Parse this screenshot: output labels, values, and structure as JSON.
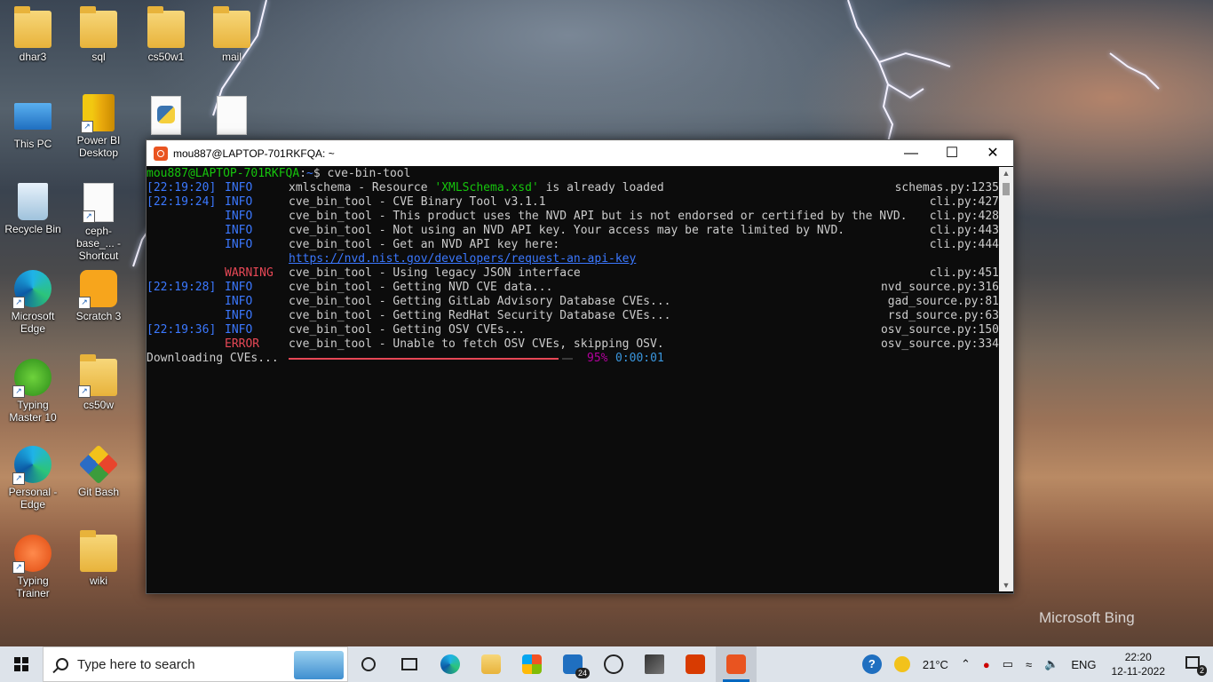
{
  "desktop": {
    "icons": [
      {
        "label": "dhar3"
      },
      {
        "label": "sql"
      },
      {
        "label": "cs50w1"
      },
      {
        "label": "mail"
      },
      {
        "label": "This PC"
      },
      {
        "label": "Power BI Desktop"
      },
      {
        "label": "Recycle Bin"
      },
      {
        "label": "ceph-base_... - Shortcut"
      },
      {
        "label": "Microsoft Edge"
      },
      {
        "label": "Scratch 3"
      },
      {
        "label": "Typing Master 10"
      },
      {
        "label": "cs50w"
      },
      {
        "label": "Personal - Edge"
      },
      {
        "label": "Git Bash"
      },
      {
        "label": "Typing Trainer"
      },
      {
        "label": "wiki"
      }
    ],
    "watermark": "Microsoft Bing"
  },
  "terminal": {
    "title": "mou887@LAPTOP-701RKFQA: ~",
    "prompt": {
      "user": "mou887@LAPTOP-701RKFQA",
      "sep": ":",
      "path": "~",
      "symbol": "$ ",
      "command": "cve-bin-tool"
    },
    "lines": [
      {
        "ts": "[22:19:20]",
        "level": "INFO",
        "msg_pre": "xmlschema - Resource ",
        "msg_str": "'XMLSchema.xsd'",
        "msg_post": " is already loaded",
        "src": "schemas.py:1235"
      },
      {
        "ts": "[22:19:24]",
        "level": "INFO",
        "msg": "cve_bin_tool - CVE Binary Tool v3.1.1",
        "src": "cli.py:427"
      },
      {
        "ts": "",
        "level": "INFO",
        "msg": "cve_bin_tool - This product uses the NVD API but is not endorsed or certified by the NVD.",
        "src": "cli.py:428"
      },
      {
        "ts": "",
        "level": "INFO",
        "msg": "cve_bin_tool - Not using an NVD API key. Your access may be rate limited by NVD.",
        "src": "cli.py:443"
      },
      {
        "ts": "",
        "level": "INFO",
        "msg": "cve_bin_tool - Get an NVD API key here:",
        "src": "cli.py:444"
      },
      {
        "ts": "",
        "level": "",
        "link": "https://nvd.nist.gov/developers/request-an-api-key",
        "src": ""
      },
      {
        "ts": "",
        "level": "WARNING",
        "msg": "cve_bin_tool - Using legacy JSON interface",
        "src": "cli.py:451"
      },
      {
        "ts": "[22:19:28]",
        "level": "INFO",
        "msg": "cve_bin_tool - Getting NVD CVE data...",
        "src": "nvd_source.py:316"
      },
      {
        "ts": "",
        "level": "INFO",
        "msg": "cve_bin_tool - Getting GitLab Advisory Database CVEs...",
        "src": "gad_source.py:81"
      },
      {
        "ts": "",
        "level": "INFO",
        "msg": "cve_bin_tool - Getting RedHat Security Database CVEs...",
        "src": "rsd_source.py:63"
      },
      {
        "ts": "[22:19:36]",
        "level": "INFO",
        "msg": "cve_bin_tool - Getting OSV CVEs...",
        "src": "osv_source.py:150"
      },
      {
        "ts": "",
        "level": "ERROR",
        "msg": "cve_bin_tool - Unable to fetch OSV CVEs, skipping OSV.",
        "src": "osv_source.py:334"
      }
    ],
    "progress": {
      "label": "Downloading CVEs...",
      "percent_text": "95%",
      "percent": 95,
      "eta": "0:00:01"
    }
  },
  "taskbar": {
    "search_placeholder": "Type here to search",
    "weather": "21°C",
    "language": "ENG",
    "time": "22:20",
    "date": "12-11-2022",
    "mail_badge": "24",
    "notification_badge": "2"
  },
  "colors": {
    "ubuntu": "#e95420",
    "accent": "#0067c0"
  }
}
